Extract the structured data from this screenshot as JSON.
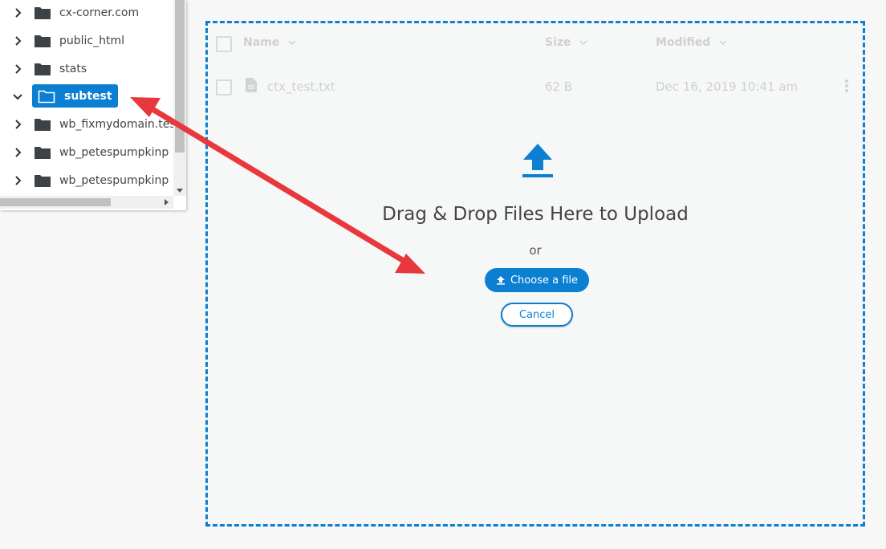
{
  "tree": {
    "items": [
      {
        "label": "cx-corner.com",
        "expanded": false,
        "selected": false
      },
      {
        "label": "public_html",
        "expanded": false,
        "selected": false
      },
      {
        "label": "stats",
        "expanded": false,
        "selected": false
      },
      {
        "label": "subtest",
        "expanded": true,
        "selected": true
      },
      {
        "label": "wb_fixmydomain.tes",
        "expanded": false,
        "selected": false
      },
      {
        "label": "wb_petespumpkinp",
        "expanded": false,
        "selected": false
      },
      {
        "label": "wb_petespumpkinp",
        "expanded": false,
        "selected": false
      }
    ]
  },
  "file_list": {
    "columns": {
      "name": "Name",
      "size": "Size",
      "modified": "Modified"
    },
    "rows": [
      {
        "name": "ctx_test.txt",
        "size": "62 B",
        "modified": "Dec 16, 2019 10:41 am"
      }
    ]
  },
  "dropzone": {
    "title": "Drag & Drop Files Here to Upload",
    "or_text": "or",
    "choose_label": "Choose a file",
    "cancel_label": "Cancel"
  },
  "colors": {
    "accent": "#0b7fd1",
    "annotation_arrow": "#e8383d"
  }
}
